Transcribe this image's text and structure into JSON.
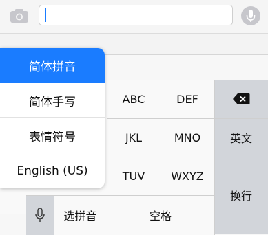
{
  "search": {
    "value": "",
    "placeholder": ""
  },
  "icons": {
    "camera": "camera-icon",
    "microphone": "microphone-icon",
    "backspace": "backspace-icon"
  },
  "colors": {
    "accent": "#1a7cff",
    "function_key": "#d2d5da"
  },
  "input_menu": {
    "items": [
      {
        "label": "简体拼音",
        "selected": true
      },
      {
        "label": "简体手写",
        "selected": false
      },
      {
        "label": "表情符号",
        "selected": false
      },
      {
        "label": "English (US)",
        "selected": false
      }
    ]
  },
  "keys": {
    "abc": "ABC",
    "def": "DEF",
    "jkl": "JKL",
    "mno": "MNO",
    "tuv": "TUV",
    "wxyz": "WXYZ",
    "english": "英文",
    "enter": "换行",
    "choose_pinyin": "选拼音",
    "space": "空格"
  }
}
